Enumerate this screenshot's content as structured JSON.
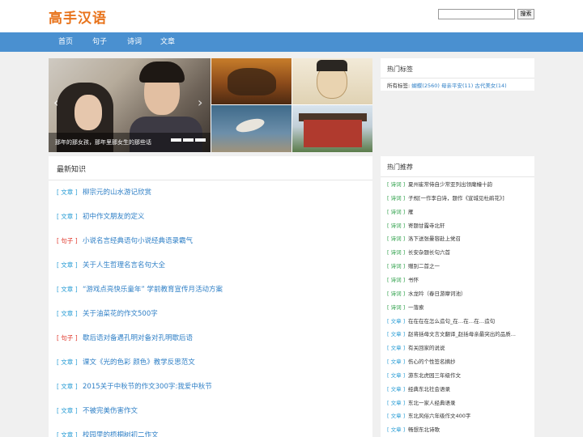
{
  "header": {
    "logo": "高手汉语",
    "search_placeholder": "",
    "search_button": "搜索"
  },
  "nav": {
    "items": [
      "首页",
      "句子",
      "诗词",
      "文章"
    ]
  },
  "banner": {
    "caption": "那年的那女孩，那年里那女生的那些话"
  },
  "latest": {
    "title": "最新知识",
    "items": [
      {
        "tag": "[ 文章 ]",
        "title": "柳宗元的山水游记欣赏",
        "color": "#2e9fd6"
      },
      {
        "tag": "[ 文章 ]",
        "title": "初中作文朋友的定义",
        "color": "#2e9fd6"
      },
      {
        "tag": "[ 句子 ]",
        "title": "小说名言经典语句小说经典语录霸气",
        "color": "#e03a2e"
      },
      {
        "tag": "[ 文章 ]",
        "title": "关于人生哲理名言名句大全",
        "color": "#2e9fd6"
      },
      {
        "tag": "[ 文章 ]",
        "title": "“游戏点亮快乐童年” 学前教育宣传月活动方案",
        "color": "#2e9fd6"
      },
      {
        "tag": "[ 文章 ]",
        "title": "关于油菜花的作文500字",
        "color": "#2e9fd6"
      },
      {
        "tag": "[ 句子 ]",
        "title": "歇后语对备遇孔明对备对孔明歇后语",
        "color": "#e03a2e"
      },
      {
        "tag": "[ 文章 ]",
        "title": "课文《光的色彩 颜色》教学反思范文",
        "color": "#2e9fd6"
      },
      {
        "tag": "[ 文章 ]",
        "title": "2015关于中秋节的作文300字:我爱中秋节",
        "color": "#2e9fd6"
      },
      {
        "tag": "[ 文章 ]",
        "title": "不被完美伤害作文",
        "color": "#2e9fd6"
      },
      {
        "tag": "[ 文章 ]",
        "title": "校园里的梧桐树初二作文",
        "color": "#2e9fd6"
      }
    ]
  },
  "hot_tags": {
    "title": "热门标签",
    "label": "所有标签:",
    "links": "蝴蝶(2560) 母亲平安(11) 古代美女(14)"
  },
  "hot_rec": {
    "title": "热门推荐",
    "items": [
      {
        "tag": "[ 诗词 ]",
        "title": "夏州崔常侍自少常亚列出领麾幢十韵",
        "color": "#2ea04a"
      },
      {
        "tag": "[ 诗词 ]",
        "title": "子规[一作李白诗，题作《宣城见杜鹃花》]",
        "color": "#2ea04a"
      },
      {
        "tag": "[ 诗词 ]",
        "title": "雁",
        "color": "#2ea04a"
      },
      {
        "tag": "[ 诗词 ]",
        "title": "寄题甘露寺北轩",
        "color": "#2ea04a"
      },
      {
        "tag": "[ 诗词 ]",
        "title": "洛下送张曼容赴上党召",
        "color": "#2ea04a"
      },
      {
        "tag": "[ 诗词 ]",
        "title": "长安杂题长句六首",
        "color": "#2ea04a"
      },
      {
        "tag": "[ 诗词 ]",
        "title": "赠别二首之一",
        "color": "#2ea04a"
      },
      {
        "tag": "[ 诗词 ]",
        "title": "书怀",
        "color": "#2ea04a"
      },
      {
        "tag": "[ 诗词 ]",
        "title": "水龙吟（春日游摩诃池）",
        "color": "#2ea04a"
      },
      {
        "tag": "[ 诗词 ]",
        "title": "一落索",
        "color": "#2ea04a"
      },
      {
        "tag": "[ 文章 ]",
        "title": "在在在在怎么造句_在…在…在…造句",
        "color": "#2e9fd6"
      },
      {
        "tag": "[ 文章 ]",
        "title": "赵将括母文言文翻译_赵括母亲最突出的品质...",
        "color": "#2e9fd6"
      },
      {
        "tag": "[ 文章 ]",
        "title": "有关回家的说说",
        "color": "#2e9fd6"
      },
      {
        "tag": "[ 文章 ]",
        "title": "伤心的个性签名摘抄",
        "color": "#2e9fd6"
      },
      {
        "tag": "[ 文章 ]",
        "title": "游东北虎园三年级作文",
        "color": "#2e9fd6"
      },
      {
        "tag": "[ 文章 ]",
        "title": "经典东北社会语录",
        "color": "#2e9fd6"
      },
      {
        "tag": "[ 文章 ]",
        "title": "东北一家人经典语录",
        "color": "#2e9fd6"
      },
      {
        "tag": "[ 文章 ]",
        "title": "东北风俗六年级作文400字",
        "color": "#2e9fd6"
      },
      {
        "tag": "[ 文章 ]",
        "title": "畅想东北诗歌",
        "color": "#2e9fd6"
      }
    ]
  }
}
